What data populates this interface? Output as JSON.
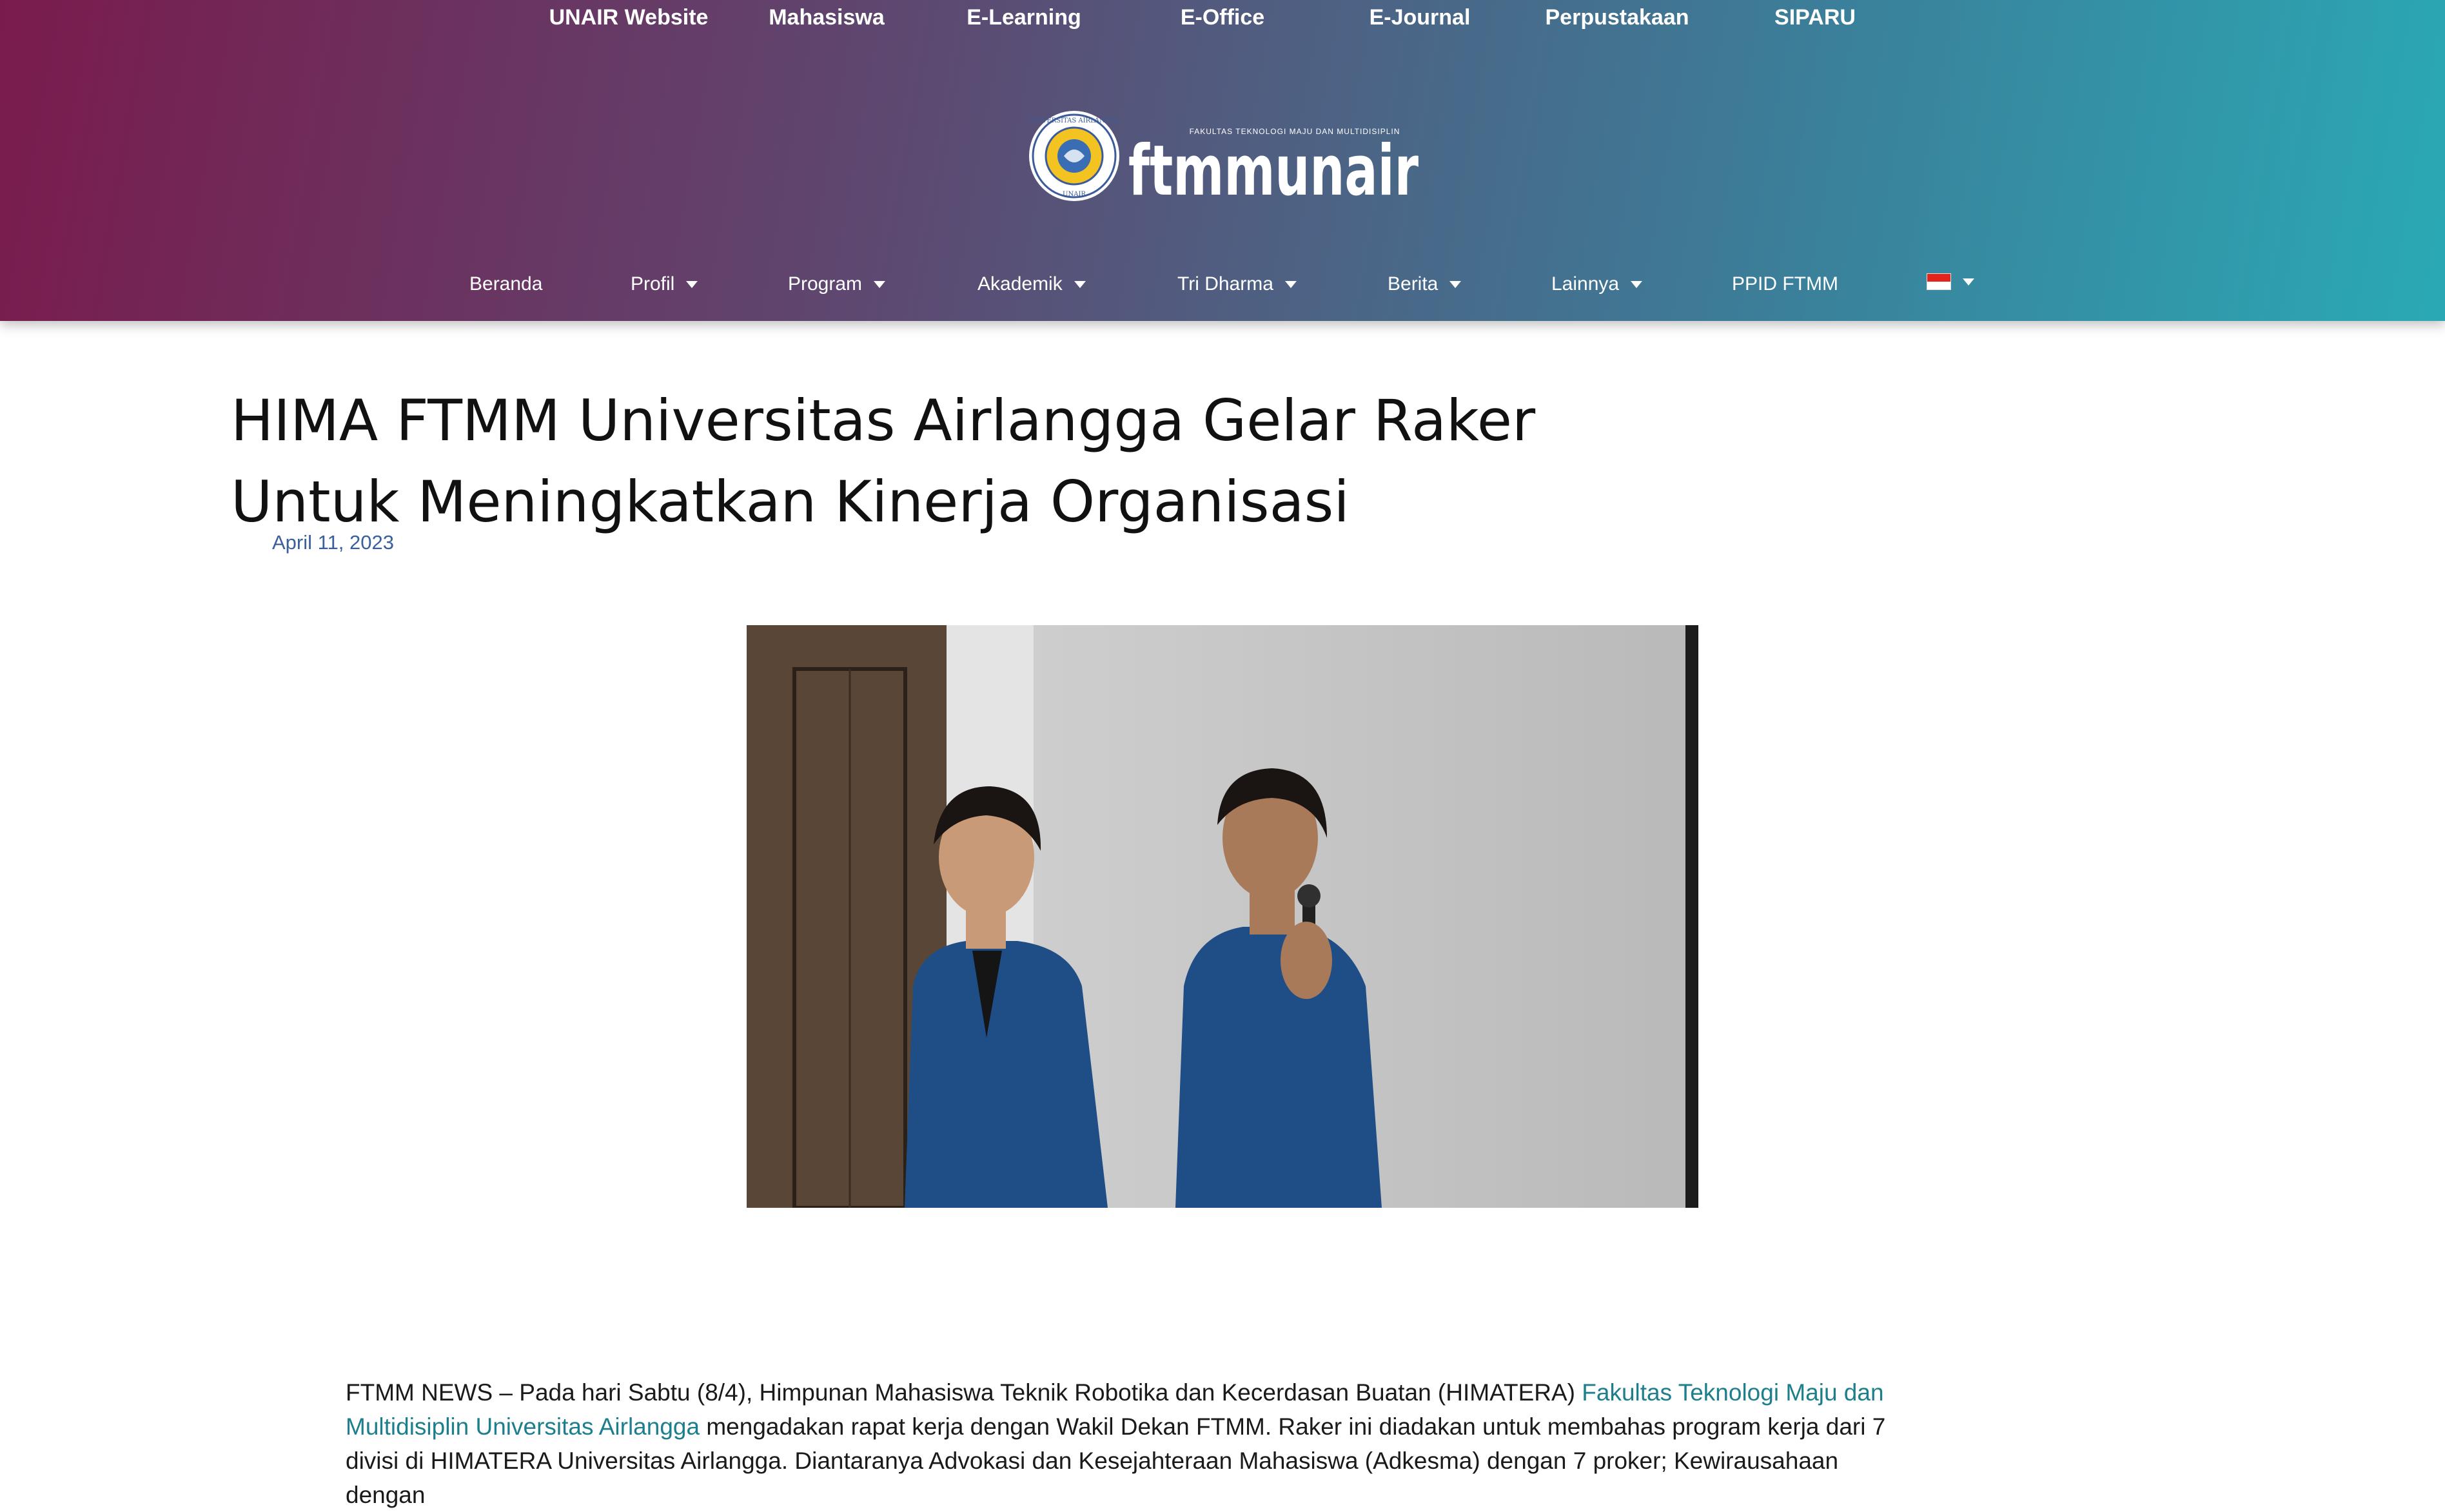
{
  "top_nav": [
    "UNAIR Website",
    "Mahasiswa",
    "E-Learning",
    "E-Office",
    "E-Journal",
    "Perpustakaan",
    "SIPARU"
  ],
  "logo": {
    "seal_text": "UNIVERSITAS AIRLANGGA",
    "seal_bottom": "UNAIR",
    "wordmark": "ftmmunair",
    "tagline": "FAKULTAS TEKNOLOGI MAJU DAN MULTIDISIPLIN"
  },
  "main_nav": {
    "beranda": "Beranda",
    "profil": "Profil",
    "program": "Program",
    "akademik": "Akademik",
    "tri_dharma": "Tri Dharma",
    "berita": "Berita",
    "lainnya": "Lainnya",
    "ppid": "PPID FTMM"
  },
  "article": {
    "title": "HIMA FTMM Universitas Airlangga Gelar Raker Untuk Meningkatkan Kinerja Organisasi",
    "date": "April 11, 2023",
    "p1_start": "FTMM NEWS – Pada hari Sabtu (8/4), Himpunan Mahasiswa Teknik Robotika dan Kecerdasan Buatan (HIMATERA) ",
    "p1_link": "Fakultas Teknologi Maju dan Multidisiplin Universitas Airlangga",
    "p1_end": " mengadakan rapat kerja dengan Wakil Dekan FTMM. Raker ini diadakan untuk membahas program kerja dari 7 divisi di HIMATERA Universitas Airlangga. Diantaranya Advokasi dan Kesejahteraan Mahasiswa (Adkesma) dengan 7 proker; Kewirausahaan dengan"
  },
  "colors": {
    "gradient_left": "#7a1b4d",
    "gradient_right": "#2aa9b5",
    "link": "#1e7f8c",
    "date": "#3a5f9a"
  }
}
